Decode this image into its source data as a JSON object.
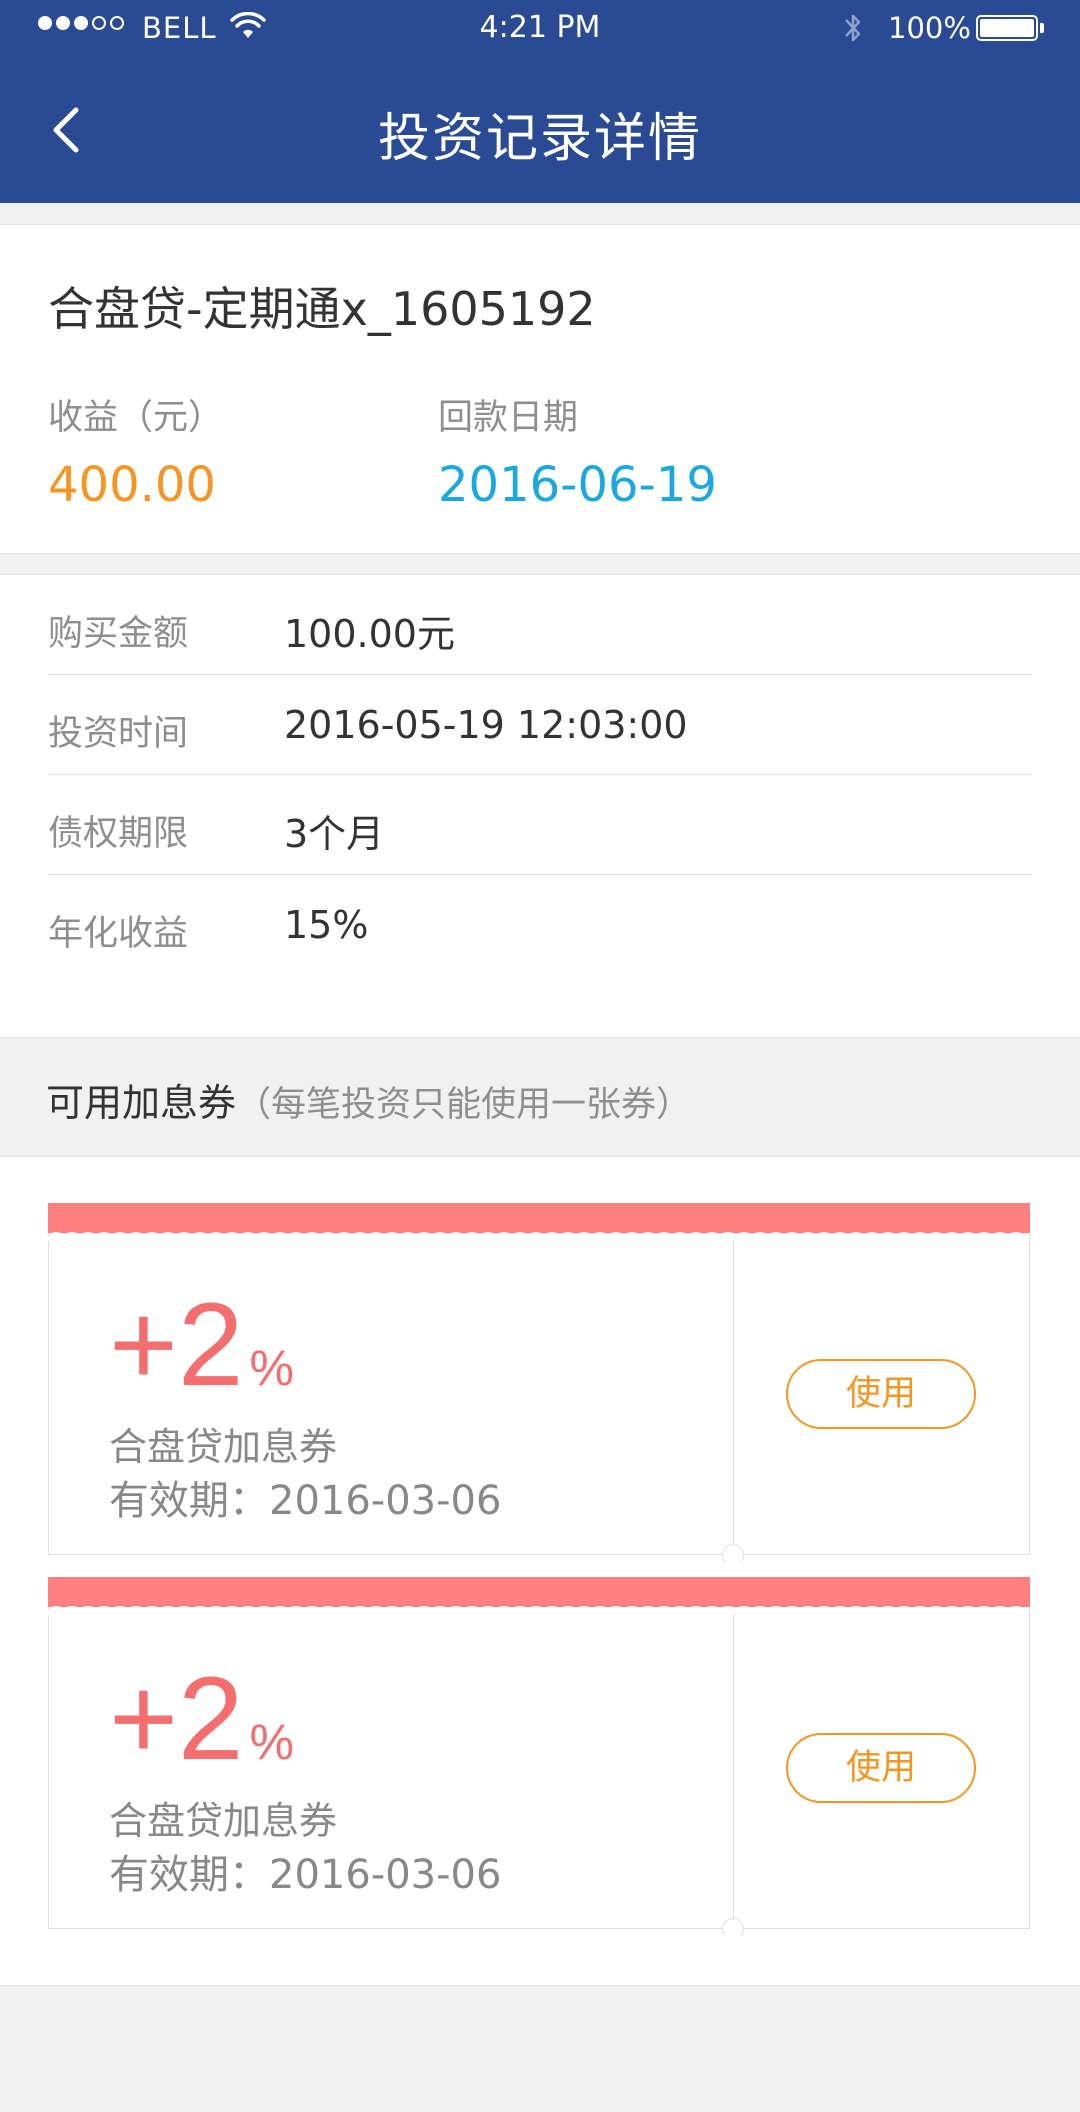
{
  "status_bar": {
    "carrier": "BELL",
    "time": "4:21 PM",
    "battery": "100%",
    "battery_level": 1.0,
    "signal_strength": 3,
    "signal_total": 5
  },
  "header": {
    "title": "投资记录详情",
    "back_icon": "chevron-left-icon"
  },
  "summary": {
    "product_name": "合盘贷-定期通x_1605192",
    "earnings_label": "收益（元）",
    "earnings_value": "400.00",
    "repay_date_label": "回款日期",
    "repay_date_value": "2016-06-19"
  },
  "details": [
    {
      "label": "购买金额",
      "value": "100.00元"
    },
    {
      "label": "投资时间",
      "value": "2016-05-19  12:03:00"
    },
    {
      "label": "债权期限",
      "value": "3个月"
    },
    {
      "label": "年化收益",
      "value": "15%"
    }
  ],
  "coupons_section": {
    "title": "可用加息券",
    "subtitle": "（每笔投资只能使用一张券）"
  },
  "coupons": [
    {
      "rate": "+2",
      "unit": "%",
      "name": "合盘贷加息券",
      "expiry": "有效期：2016-03-06",
      "button": "使用"
    },
    {
      "rate": "+2",
      "unit": "%",
      "name": "合盘贷加息券",
      "expiry": "有效期：2016-03-06",
      "button": "使用"
    }
  ],
  "colors": {
    "header_bg": "#2a4b94",
    "earnings": "#f89522",
    "date": "#1aa8e0",
    "coupon_accent": "#f46e6f",
    "coupon_band": "#ff8080",
    "button": "#f89522"
  }
}
